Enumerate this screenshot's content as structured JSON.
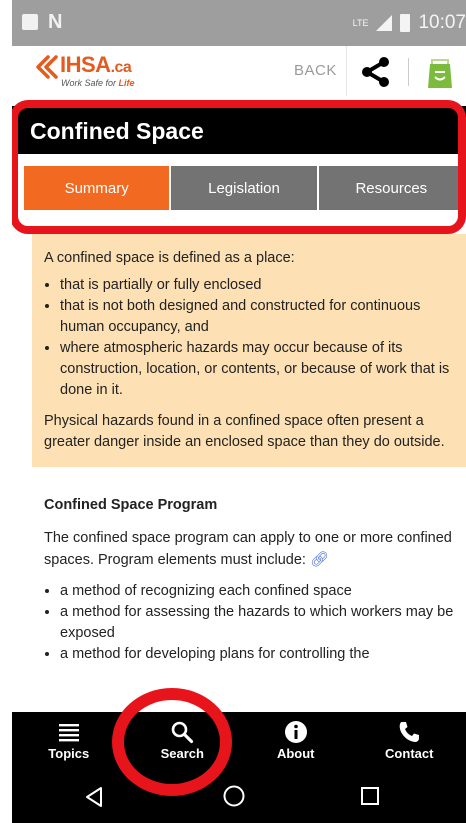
{
  "status_bar": {
    "time": "10:07",
    "network": "LTE"
  },
  "header": {
    "logo_text": "IHSA",
    "logo_suffix": ".ca",
    "logo_tagline_prefix": "Work Safe for ",
    "logo_tagline_accent": "Life",
    "back_label": "BACK",
    "icons": [
      "share-icon",
      "shopping-bag-icon"
    ]
  },
  "page": {
    "title": "Confined Space",
    "tabs": [
      {
        "label": "Summary",
        "active": true
      },
      {
        "label": "Legislation",
        "active": false
      },
      {
        "label": "Resources",
        "active": false
      }
    ]
  },
  "content": {
    "intro": "A confined space is defined as a place:",
    "bullets": [
      "that is partially or fully enclosed",
      "that is not both designed and constructed for continuous human occupancy, and",
      "where atmospheric hazards may occur because of its construction, location, or contents, or because of work that is done in it."
    ],
    "note": "Physical hazards found in a confined space often present a greater danger inside an enclosed space than they do outside.",
    "program_heading": "Confined Space Program",
    "program_text": "The confined space program can apply to one or more confined spaces. Program elements must include:",
    "program_bullets": [
      "a method of recognizing each confined space",
      "a method for assessing the hazards to which workers may be exposed",
      "a method for developing plans for controlling the"
    ]
  },
  "bottom_nav": [
    {
      "label": "Topics",
      "icon": "list-icon"
    },
    {
      "label": "Search",
      "icon": "search-icon"
    },
    {
      "label": "About",
      "icon": "info-icon"
    },
    {
      "label": "Contact",
      "icon": "phone-icon"
    }
  ],
  "colors": {
    "accent": "#f26a21",
    "tab_inactive": "#737373",
    "highlight_box": "#fde0b4",
    "annotation_red": "#e8141c"
  }
}
